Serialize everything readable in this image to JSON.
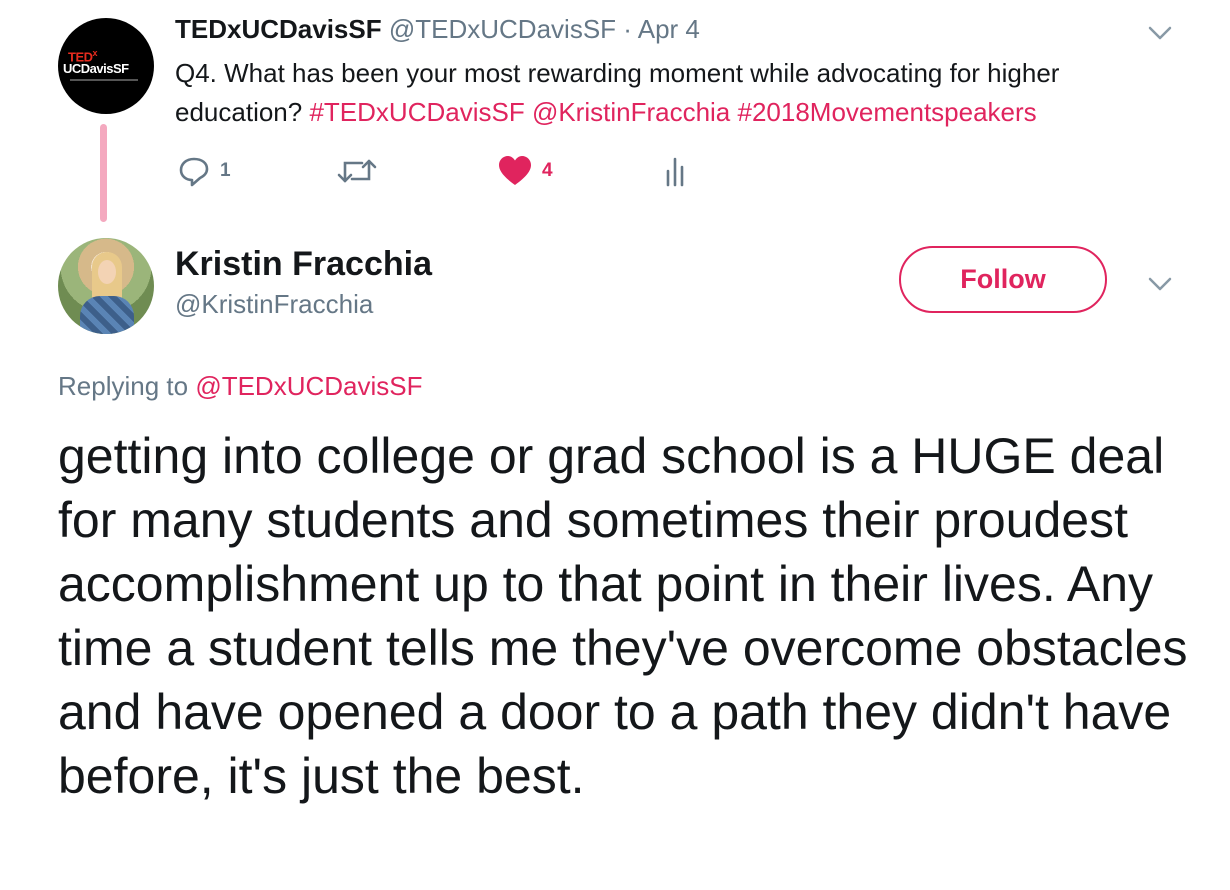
{
  "parent_tweet": {
    "avatar_text_brand": "TED",
    "avatar_text_x": "x",
    "avatar_text_name": "UCDavisSF",
    "author_name": "TEDxUCDavisSF",
    "handle": "@TEDxUCDavisSF",
    "separator": "·",
    "date": "Apr 4",
    "text_plain": "Q4. What has been your most rewarding moment while advocating for higher education? ",
    "links": [
      "#TEDxUCDavisSF",
      "@KristinFracchia",
      "#2018Movementspeakers"
    ],
    "reply_count": "1",
    "like_count": "4",
    "menu_icon": "chevron-down-icon"
  },
  "reply_tweet": {
    "author_name": "Kristin Fracchia",
    "handle": "@KristinFracchia",
    "follow_label": "Follow",
    "replying_prefix": "Replying to ",
    "replying_handle": "@TEDxUCDavisSF",
    "text": "getting into college or grad school is a HUGE deal for many students and sometimes their proudest accomplishment up to that point in their lives. Any time a student tells me they've overcome obstacles and have opened a door to a path they didn't have before, it's just the best."
  },
  "colors": {
    "accent": "#e0245e",
    "secondary_text": "#657786",
    "thread_line": "#f4a9bf"
  }
}
